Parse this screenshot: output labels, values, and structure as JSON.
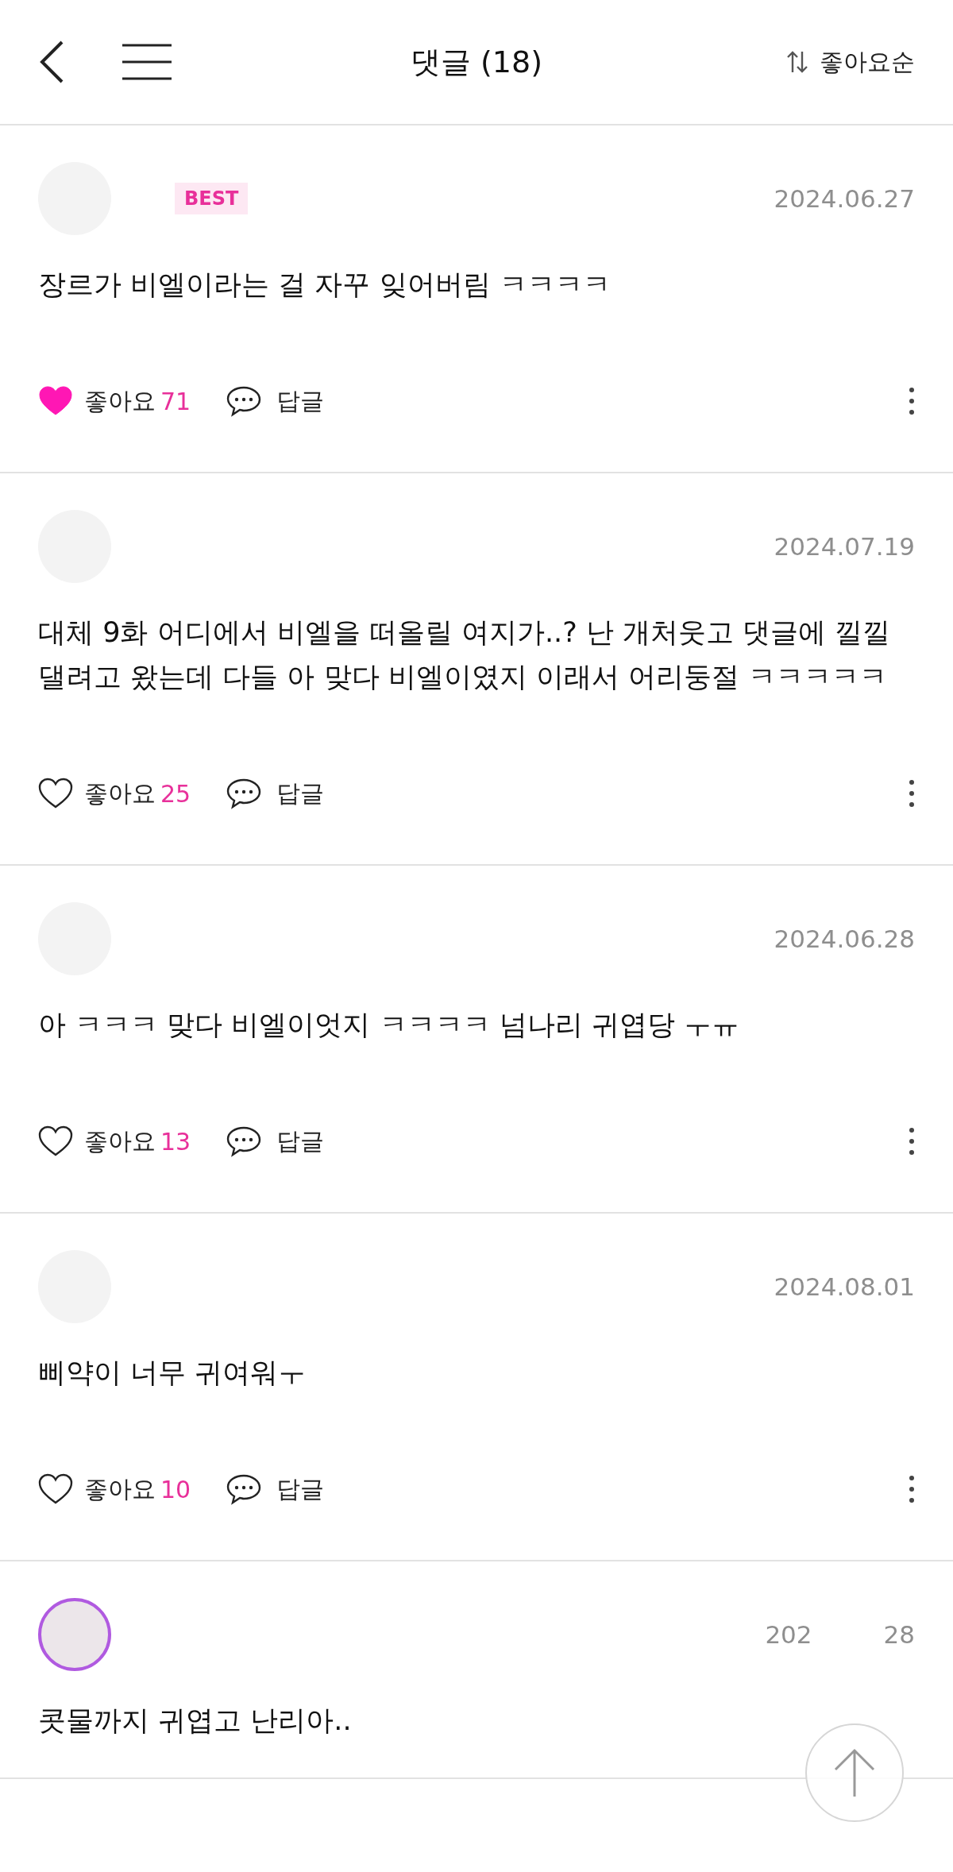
{
  "header": {
    "title": "댓글 (18)",
    "sort": "좋아요순"
  },
  "comments": [
    {
      "best": true,
      "avatar_ring": false,
      "date": [
        "2024.06.27"
      ],
      "text": "장르가 비엘이라는 걸 자꾸 잊어버림 ㅋㅋㅋㅋ",
      "liked": true,
      "like_label": "좋아요",
      "likes": "71",
      "reply_label": "답글"
    },
    {
      "best": false,
      "avatar_ring": false,
      "date": [
        "2024.07.19"
      ],
      "text": "대체 9화 어디에서 비엘을 떠올릴 여지가..? 난 개처웃고 댓글에 낄낄댈려고 왔는데 다들 아 맞다 비엘이였지 이래서 어리둥절 ㅋㅋㅋㅋㅋ",
      "liked": false,
      "like_label": "좋아요",
      "likes": "25",
      "reply_label": "답글"
    },
    {
      "best": false,
      "avatar_ring": false,
      "date": [
        "2024.06.28"
      ],
      "text": "아 ㅋㅋㅋ 맞다 비엘이엇지 ㅋㅋㅋㅋ 넘나리 귀엽당 ㅜㅠ",
      "liked": false,
      "like_label": "좋아요",
      "likes": "13",
      "reply_label": "답글"
    },
    {
      "best": false,
      "avatar_ring": false,
      "date": [
        "2024.08.01"
      ],
      "text": "삐약이 너무 귀여워ㅜ",
      "liked": false,
      "like_label": "좋아요",
      "likes": "10",
      "reply_label": "답글"
    },
    {
      "best": false,
      "avatar_ring": true,
      "date": [
        "202",
        "28"
      ],
      "text": "콧물까지 귀엽고 난리아.."
    }
  ],
  "best_label": "BEST"
}
